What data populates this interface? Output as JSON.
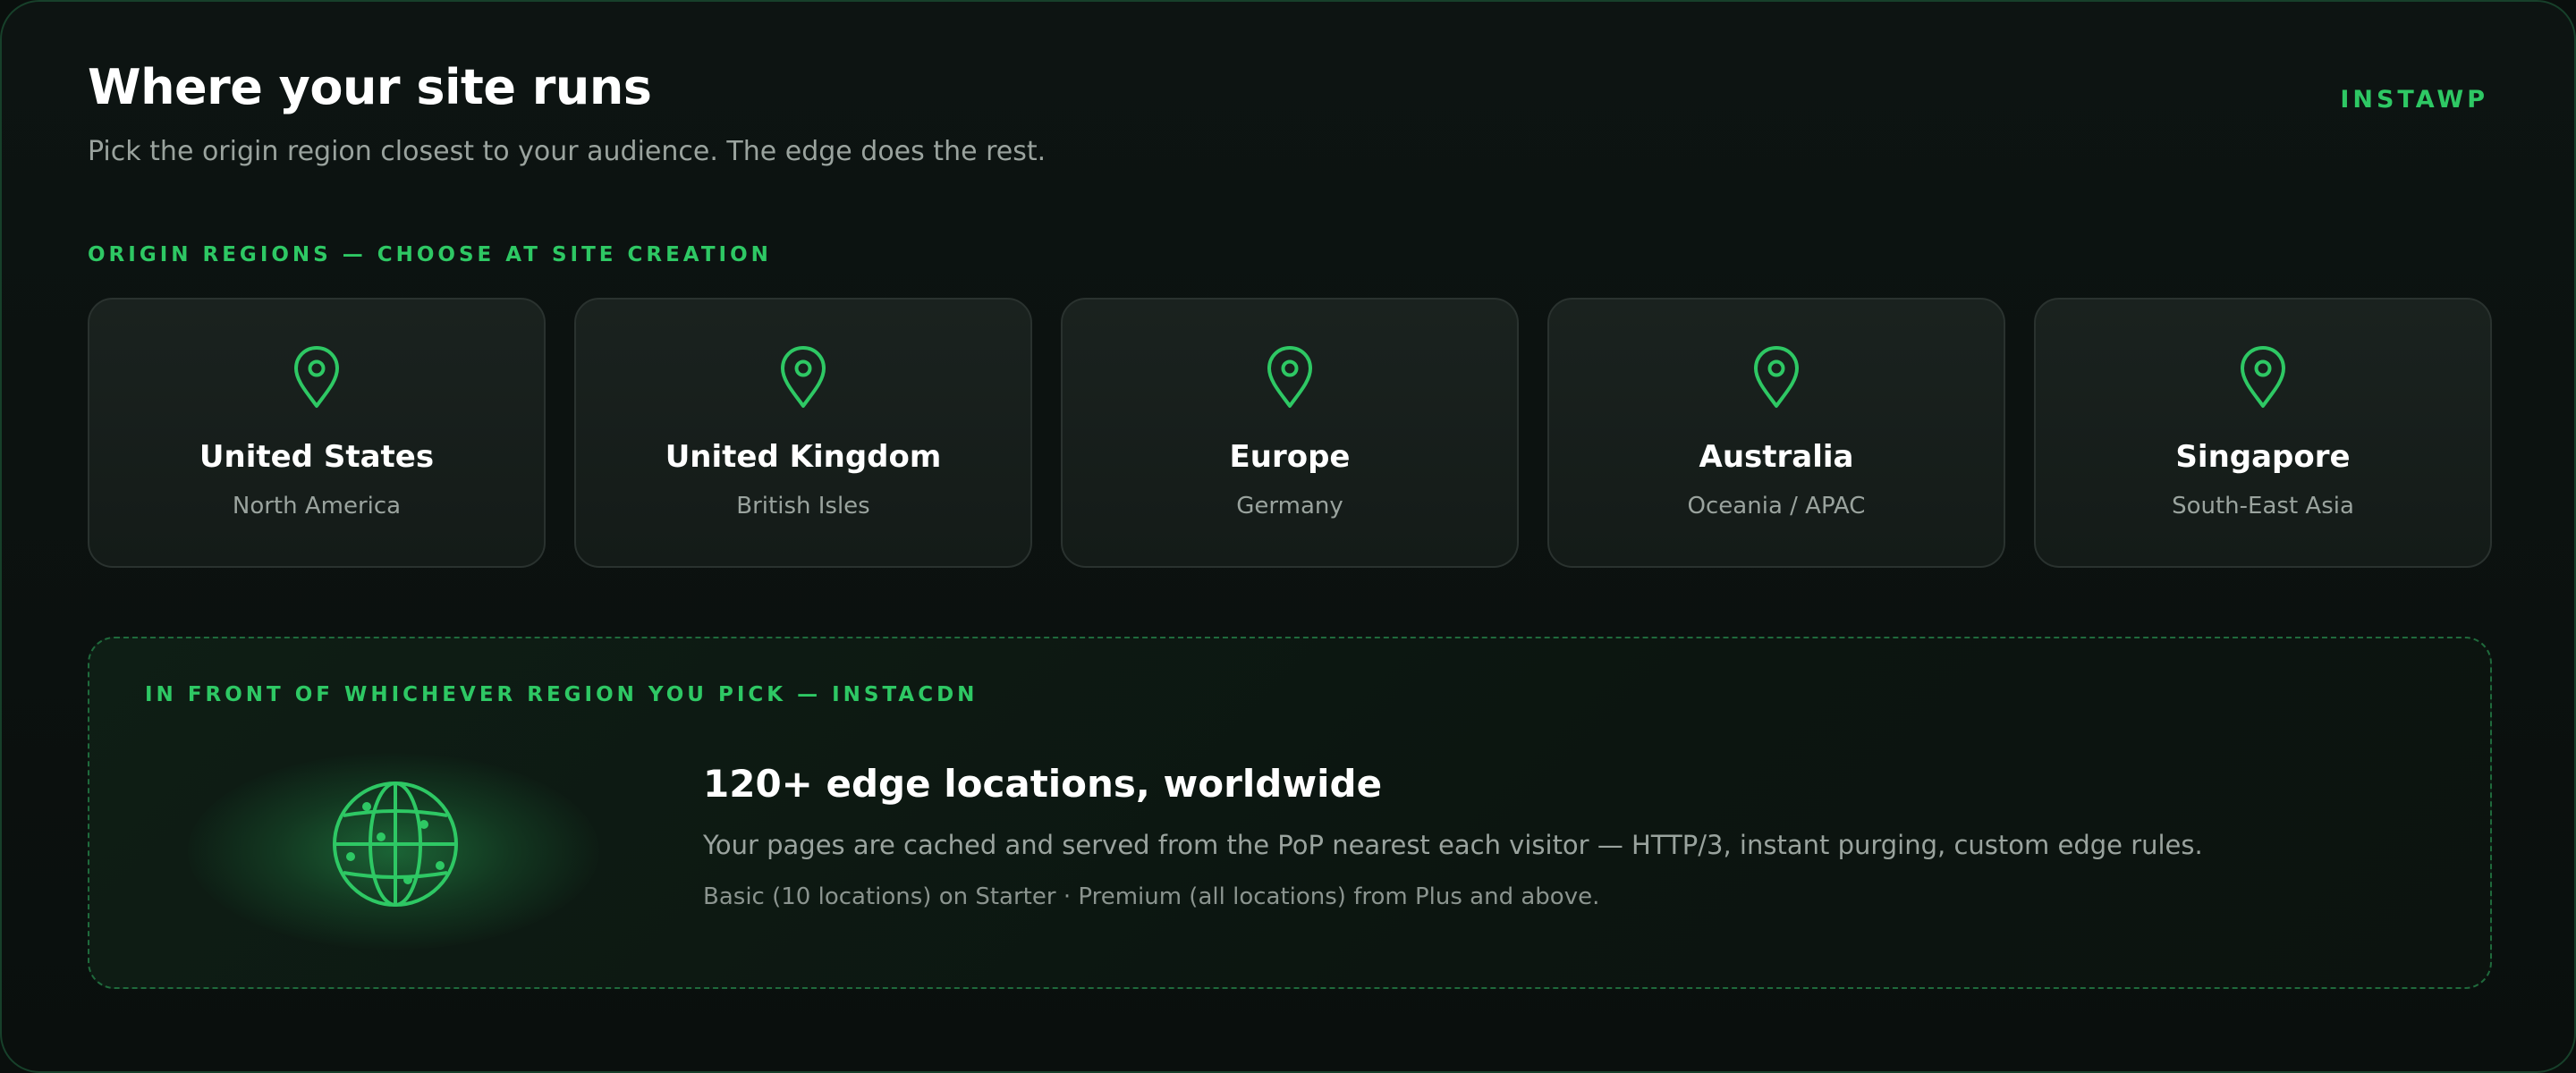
{
  "header": {
    "title": "Where your site runs",
    "subtitle": "Pick the origin region closest to your audience. The edge does the rest.",
    "brand": "INSTAWP"
  },
  "origin": {
    "label": "ORIGIN REGIONS — CHOOSE AT SITE CREATION",
    "icon": "map-pin-icon",
    "regions": [
      {
        "name": "United States",
        "sub": "North America"
      },
      {
        "name": "United Kingdom",
        "sub": "British Isles"
      },
      {
        "name": "Europe",
        "sub": "Germany"
      },
      {
        "name": "Australia",
        "sub": "Oceania / APAC"
      },
      {
        "name": "Singapore",
        "sub": "South-East Asia"
      }
    ]
  },
  "cdn": {
    "label": "IN FRONT OF WHICHEVER REGION YOU PICK — INSTACDN",
    "icon": "globe-icon",
    "heading": "120+ edge locations, worldwide",
    "description": "Your pages are cached and served from the PoP nearest each visitor — HTTP/3, instant purging, custom edge rules.",
    "note": "Basic (10 locations) on Starter · Premium (all locations) from Plus and above."
  },
  "colors": {
    "accent": "#2ec864",
    "background": "#0a0f0d",
    "card": "#18201d",
    "muted_text": "#9aa39e"
  }
}
